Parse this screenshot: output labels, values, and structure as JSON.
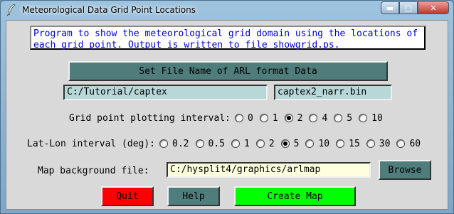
{
  "window": {
    "title": "Meteorological Data Grid Point Locations",
    "controls": {
      "minimize": "▬",
      "maximize": "□",
      "close": "✕"
    }
  },
  "description": "Program to show the meteorological grid domain using the locations of\neach grid point. Output is written to file showgrid.ps.",
  "set_file_button": "Set File Name of ARL format Data",
  "data_directory": "C:/Tutorial/captex",
  "data_filename": "captex2_narr.bin",
  "grid_interval": {
    "label": "Grid point plotting interval:",
    "options": [
      "0",
      "1",
      "2",
      "4",
      "5",
      "10"
    ],
    "selected": "2"
  },
  "latlon_interval": {
    "label": "Lat-Lon interval (deg):",
    "options": [
      "0.2",
      "0.5",
      "1",
      "2",
      "5",
      "10",
      "15",
      "30",
      "60"
    ],
    "selected": "5"
  },
  "map_background": {
    "label": "Map background file:",
    "value": "C:/hysplit4/graphics/arlmap",
    "browse_label": "Browse"
  },
  "buttons": {
    "quit": "Quit",
    "help": "Help",
    "create_map": "Create Map"
  },
  "colors": {
    "teal_button": "#4e7d7c",
    "quit": "#ff0000",
    "create": "#00ff00",
    "entry": "#b8d8d8",
    "map_entry": "#ffffe0",
    "text_blue": "#0000dd"
  }
}
